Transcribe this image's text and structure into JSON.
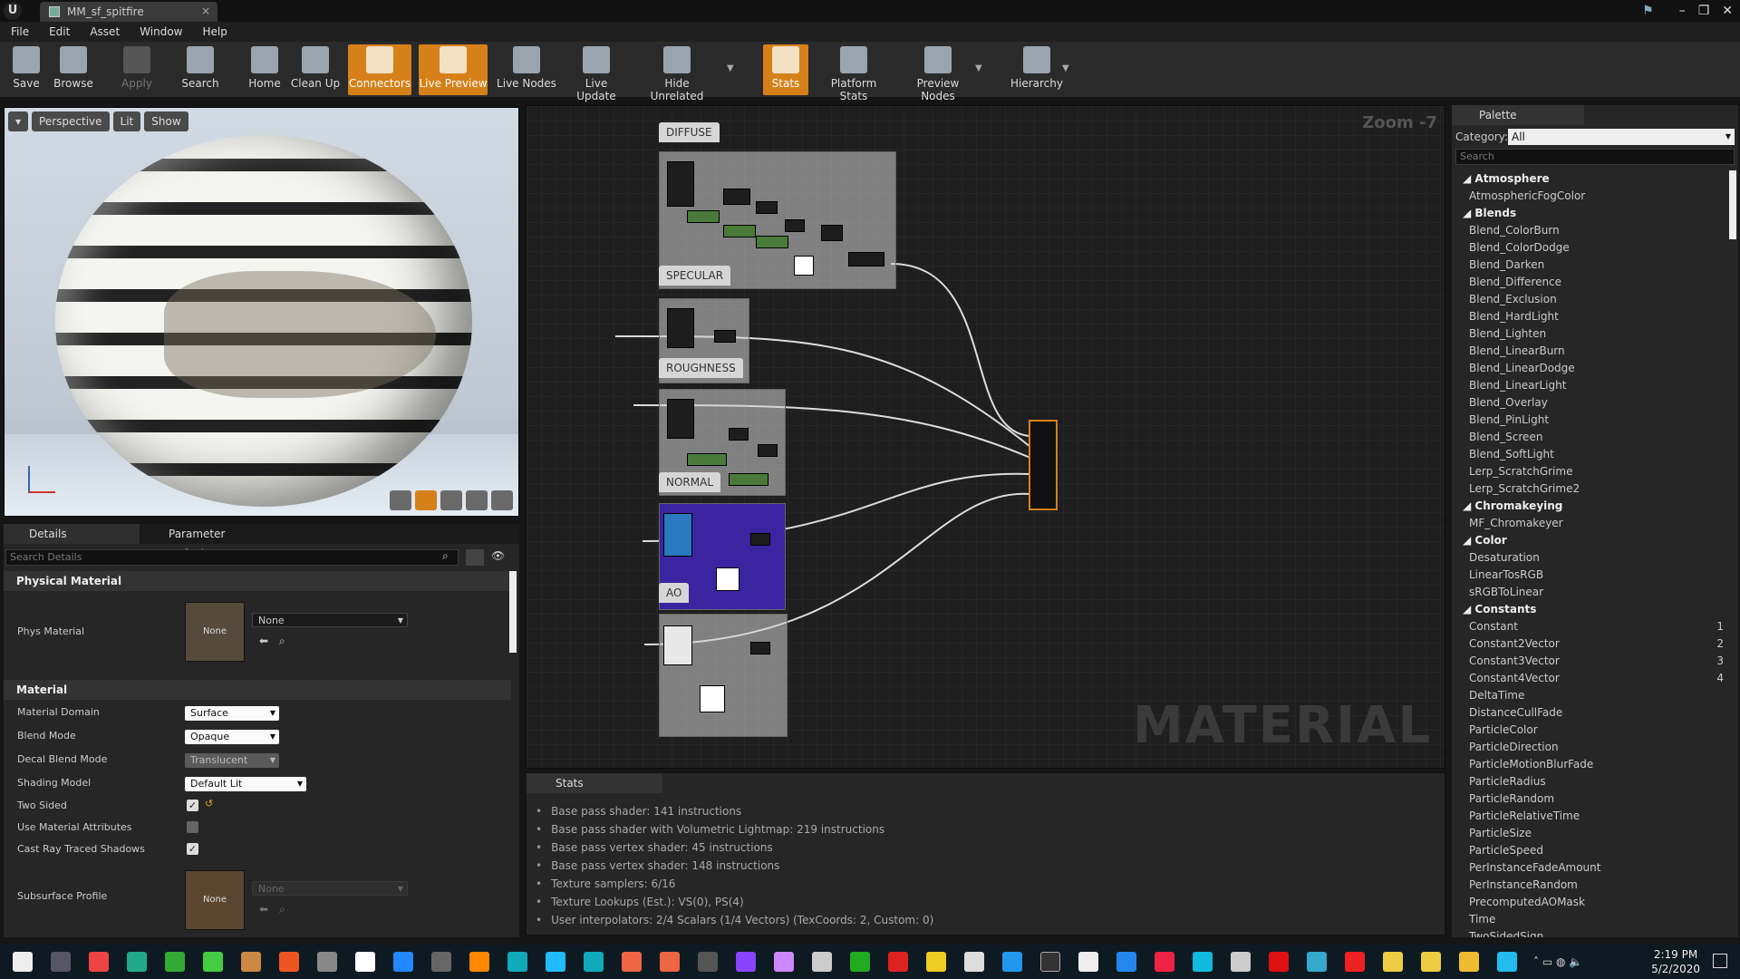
{
  "titlebar": {
    "logo": "U",
    "tab_title": "MM_sf_spitfire",
    "close": "×"
  },
  "menu": [
    "File",
    "Edit",
    "Asset",
    "Window",
    "Help"
  ],
  "toolbar": {
    "save": "Save",
    "browse": "Browse",
    "apply": "Apply",
    "search": "Search",
    "home": "Home",
    "cleanup": "Clean Up",
    "connectors": "Connectors",
    "live_preview": "Live Preview",
    "live_nodes": "Live Nodes",
    "live_update": "Live Update",
    "hide_unrelated": "Hide Unrelated",
    "stats": "Stats",
    "platform_stats": "Platform Stats",
    "preview_nodes": "Preview Nodes",
    "hierarchy": "Hierarchy"
  },
  "viewport": {
    "perspective": "Perspective",
    "lit": "Lit",
    "show": "Show"
  },
  "details": {
    "tab_details": "Details",
    "tab_params": "Parameter Defaults",
    "search_placeholder": "Search Details",
    "physical_material_section": "Physical Material",
    "phys_material_label": "Phys Material",
    "phys_material_value": "None",
    "phys_thumb": "None",
    "material_section": "Material",
    "material_domain_label": "Material Domain",
    "material_domain_value": "Surface",
    "blend_mode_label": "Blend Mode",
    "blend_mode_value": "Opaque",
    "decal_blend_label": "Decal Blend Mode",
    "decal_blend_value": "Translucent",
    "shading_model_label": "Shading Model",
    "shading_model_value": "Default Lit",
    "two_sided_label": "Two Sided",
    "two_sided": true,
    "use_mat_attr_label": "Use Material Attributes",
    "use_mat_attr": false,
    "cast_ray_label": "Cast Ray Traced Shadows",
    "cast_ray": true,
    "subsurface_label": "Subsurface Profile",
    "subsurface_value": "None",
    "subsurface_thumb": "None"
  },
  "graph": {
    "zoom": "Zoom -7",
    "watermark": "MATERIAL",
    "comments": {
      "diffuse": "DIFFUSE",
      "specular": "SPECULAR",
      "roughness": "ROUGHNESS",
      "normal": "NORMAL",
      "ao": "AO"
    }
  },
  "stats": {
    "tab": "Stats",
    "lines": [
      "Base pass shader: 141 instructions",
      "Base pass shader with Volumetric Lightmap: 219 instructions",
      "Base pass vertex shader: 45 instructions",
      "Base pass vertex shader: 148 instructions",
      "Texture samplers: 6/16",
      "Texture Lookups (Est.): VS(0), PS(4)",
      "User interpolators: 2/4 Scalars (1/4 Vectors) (TexCoords: 2, Custom: 0)"
    ]
  },
  "palette": {
    "tab": "Palette",
    "category_label": "Category:",
    "category_value": "All",
    "search_placeholder": "Search",
    "rows": [
      {
        "type": "cat",
        "label": "Atmosphere"
      },
      {
        "type": "item",
        "label": "AtmosphericFogColor"
      },
      {
        "type": "cat",
        "label": "Blends"
      },
      {
        "type": "item",
        "label": "Blend_ColorBurn"
      },
      {
        "type": "item",
        "label": "Blend_ColorDodge"
      },
      {
        "type": "item",
        "label": "Blend_Darken"
      },
      {
        "type": "item",
        "label": "Blend_Difference"
      },
      {
        "type": "item",
        "label": "Blend_Exclusion"
      },
      {
        "type": "item",
        "label": "Blend_HardLight"
      },
      {
        "type": "item",
        "label": "Blend_Lighten"
      },
      {
        "type": "item",
        "label": "Blend_LinearBurn"
      },
      {
        "type": "item",
        "label": "Blend_LinearDodge"
      },
      {
        "type": "item",
        "label": "Blend_LinearLight"
      },
      {
        "type": "item",
        "label": "Blend_Overlay"
      },
      {
        "type": "item",
        "label": "Blend_PinLight"
      },
      {
        "type": "item",
        "label": "Blend_Screen"
      },
      {
        "type": "item",
        "label": "Blend_SoftLight"
      },
      {
        "type": "item",
        "label": "Lerp_ScratchGrime"
      },
      {
        "type": "item",
        "label": "Lerp_ScratchGrime2"
      },
      {
        "type": "cat",
        "label": "Chromakeying"
      },
      {
        "type": "item",
        "label": "MF_Chromakeyer"
      },
      {
        "type": "cat",
        "label": "Color"
      },
      {
        "type": "item",
        "label": "Desaturation"
      },
      {
        "type": "item",
        "label": "LinearTosRGB"
      },
      {
        "type": "item",
        "label": "sRGBToLinear"
      },
      {
        "type": "cat",
        "label": "Constants"
      },
      {
        "type": "item",
        "label": "Constant",
        "hotkey": "1"
      },
      {
        "type": "item",
        "label": "Constant2Vector",
        "hotkey": "2"
      },
      {
        "type": "item",
        "label": "Constant3Vector",
        "hotkey": "3"
      },
      {
        "type": "item",
        "label": "Constant4Vector",
        "hotkey": "4"
      },
      {
        "type": "item",
        "label": "DeltaTime"
      },
      {
        "type": "item",
        "label": "DistanceCullFade"
      },
      {
        "type": "item",
        "label": "ParticleColor"
      },
      {
        "type": "item",
        "label": "ParticleDirection"
      },
      {
        "type": "item",
        "label": "ParticleMotionBlurFade"
      },
      {
        "type": "item",
        "label": "ParticleRadius"
      },
      {
        "type": "item",
        "label": "ParticleRandom"
      },
      {
        "type": "item",
        "label": "ParticleRelativeTime"
      },
      {
        "type": "item",
        "label": "ParticleSize"
      },
      {
        "type": "item",
        "label": "ParticleSpeed"
      },
      {
        "type": "item",
        "label": "PerInstanceFadeAmount"
      },
      {
        "type": "item",
        "label": "PerInstanceRandom"
      },
      {
        "type": "item",
        "label": "PrecomputedAOMask"
      },
      {
        "type": "item",
        "label": "Time"
      },
      {
        "type": "item",
        "label": "TwoSidedSign"
      }
    ]
  },
  "taskbar": {
    "time": "2:19 PM",
    "date": "5/2/2020"
  },
  "colors": {
    "accent": "#d6801a",
    "normal_box": "#3a24a0"
  }
}
